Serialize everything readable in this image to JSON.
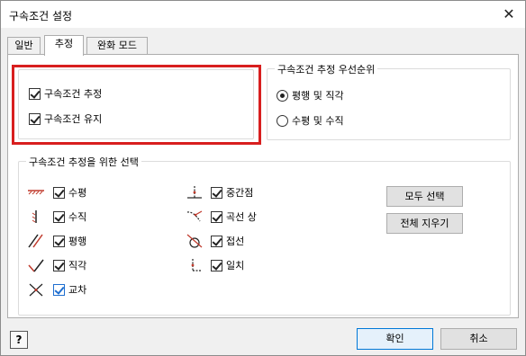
{
  "window": {
    "title": "구속조건 설정",
    "close_glyph": "✕"
  },
  "tabs": [
    {
      "label": "일반",
      "active": false
    },
    {
      "label": "추정",
      "active": true
    },
    {
      "label": "완화 모드",
      "active": false
    }
  ],
  "left_group": {
    "items": [
      {
        "label": "구속조건 추정",
        "checked": true
      },
      {
        "label": "구속조건 유지",
        "checked": true
      }
    ],
    "highlight_color": "#d81f1f"
  },
  "priority_group": {
    "title": "구속조건 추정 우선순위",
    "options": [
      {
        "label": "평행 및 직각",
        "selected": true
      },
      {
        "label": "수평 및 수직",
        "selected": false
      }
    ]
  },
  "selection_group": {
    "title": "구속조건 추정을 위한 선택",
    "left_column": [
      {
        "icon": "horizontal-constraint-icon",
        "label": "수평",
        "checked": true
      },
      {
        "icon": "vertical-constraint-icon",
        "label": "수직",
        "checked": true
      },
      {
        "icon": "parallel-constraint-icon",
        "label": "평행",
        "checked": true
      },
      {
        "icon": "perpendicular-constraint-icon",
        "label": "직각",
        "checked": true
      },
      {
        "icon": "intersection-constraint-icon",
        "label": "교차",
        "checked": true
      }
    ],
    "right_column": [
      {
        "icon": "midpoint-constraint-icon",
        "label": "중간점",
        "checked": true
      },
      {
        "icon": "on-curve-constraint-icon",
        "label": "곡선 상",
        "checked": true
      },
      {
        "icon": "tangent-constraint-icon",
        "label": "접선",
        "checked": true
      },
      {
        "icon": "coincident-constraint-icon",
        "label": "일치",
        "checked": true
      }
    ],
    "select_all_label": "모두 선택",
    "clear_all_label": "전체 지우기"
  },
  "footer": {
    "help_label": "?",
    "ok_label": "확인",
    "cancel_label": "취소"
  },
  "colors": {
    "icon_red": "#c0392b",
    "focus_blue": "#1f6fd0"
  }
}
